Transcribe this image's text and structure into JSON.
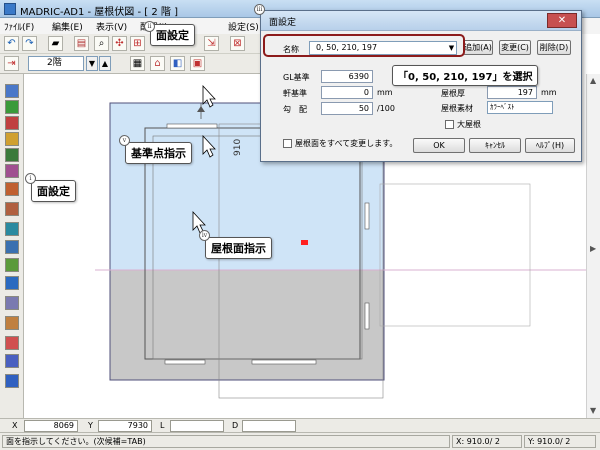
{
  "window": {
    "title": "MADRIC-AD1 - 屋根伏図 - [ 2 階 ]"
  },
  "menubar": {
    "items": [
      "ﾌｧｲﾙ(F)",
      "編集(E)",
      "表示(V)",
      "配置(I)",
      "設定(S)"
    ]
  },
  "toolbar": {
    "floor_value": "2階",
    "spin_down": "▼",
    "spin_up": "▲"
  },
  "canvas": {
    "colors": {
      "roof_face": "#cfe4f7",
      "ground": "#c8c8c8",
      "outline": "#4f4f7a",
      "marker": "#ff2020"
    },
    "dimension_label": "910"
  },
  "dialog": {
    "title": "面設定",
    "close_label": "✕",
    "name_label": "名称",
    "name_value": "0,  50,  210,  197",
    "add_button": "追加(A)",
    "change_button": "変更(C)",
    "delete_button": "削除(D)",
    "gl_label": "GL基準",
    "gl_value": "6390",
    "eave_label": "軒基準",
    "eave_value": "0",
    "eave_unit": "mm",
    "slope_label": "勾　配",
    "slope_value": "50",
    "slope_unit": "/100",
    "roof_thickness_label": "屋根厚",
    "roof_thickness_value": "197",
    "roof_thickness_unit": "mm",
    "roof_material_label": "屋根素材",
    "roof_material_value": "ｶﾗｰﾍﾞｽﾄ",
    "big_roof_label": "大屋根",
    "apply_all_label": "屋根面をすべて変更します。",
    "ok_button": "OK",
    "cancel_button": "ｷｬﾝｾﾙ",
    "help_button": "ﾍﾙﾌﾟ(H)"
  },
  "callouts": {
    "face_setting_top": "面設定",
    "face_setting_left": "面設定",
    "base_point": "基準点指示",
    "roof_face": "屋根面指示",
    "select_instruction": "「0,  50,  210,  197」を選択"
  },
  "steps": {
    "i": "i",
    "ii": "ii",
    "iii": "iii",
    "iv": "iv",
    "v": "v"
  },
  "coords": {
    "x_label": "X",
    "x_value": "8069",
    "y_label": "Y",
    "y_value": "7930",
    "l_label": "L",
    "l_value": "",
    "d_label": "D",
    "d_value": ""
  },
  "status": {
    "message": "面を指示してください。(次候補=TAB)",
    "x_grid": "X: 910.0/ 2",
    "y_grid": "Y: 910.0/ 2"
  }
}
